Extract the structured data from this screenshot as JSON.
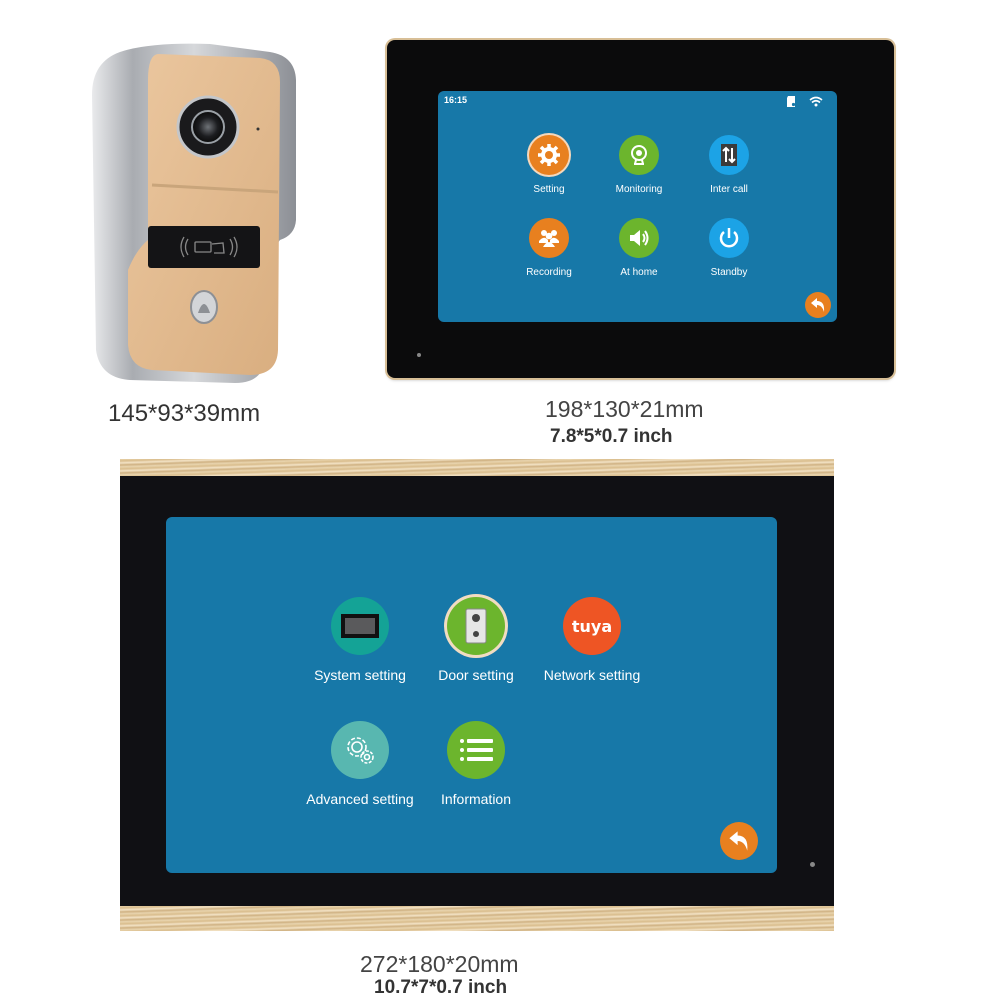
{
  "doorbell": {
    "dimensions_mm": "145*93*39mm",
    "panel_color": "#e2b88d",
    "frame_color": "#b9bcc2"
  },
  "monitor_small": {
    "dimensions_mm": "198*130*21mm",
    "dimensions_inch": "7.8*5*0.7 inch",
    "status_bar": {
      "time": "16:15",
      "icons": [
        "sd-card-icon",
        "wifi-icon"
      ]
    },
    "apps": [
      {
        "label": "Setting",
        "icon": "gear-icon",
        "color": "#e8801f"
      },
      {
        "label": "Monitoring",
        "icon": "webcam-icon",
        "color": "#6cb52d"
      },
      {
        "label": "Inter call",
        "icon": "intercom-arrows-icon",
        "color": "#1ca3e6"
      },
      {
        "label": "Recording",
        "icon": "people-icon",
        "color": "#e8801f"
      },
      {
        "label": "At home",
        "icon": "speaker-icon",
        "color": "#6cb52d"
      },
      {
        "label": "Standby",
        "icon": "power-icon",
        "color": "#1ca3e6"
      }
    ],
    "back_icon": "back-arrow-icon"
  },
  "monitor_large": {
    "dimensions_mm": "272*180*20mm",
    "dimensions_inch": "10.7*7*0.7 inch",
    "apps": [
      {
        "label": "System setting",
        "icon": "monitor-icon",
        "color": "#14a396"
      },
      {
        "label": "Door setting",
        "icon": "doorbell-icon",
        "color": "#6cb52d"
      },
      {
        "label": "Network setting",
        "icon": "tuya-icon",
        "color": "#ee5524",
        "icon_text": "tuya"
      },
      {
        "label": "Advanced setting",
        "icon": "gears-icon",
        "color": "#58b7b0"
      },
      {
        "label": "Information",
        "icon": "list-icon",
        "color": "#6cb52d"
      }
    ],
    "back_icon": "back-arrow-icon"
  },
  "colors": {
    "screen": "#1778a8",
    "bezel": "#0b0b0c",
    "gold_trim": "#d9bd8d"
  }
}
